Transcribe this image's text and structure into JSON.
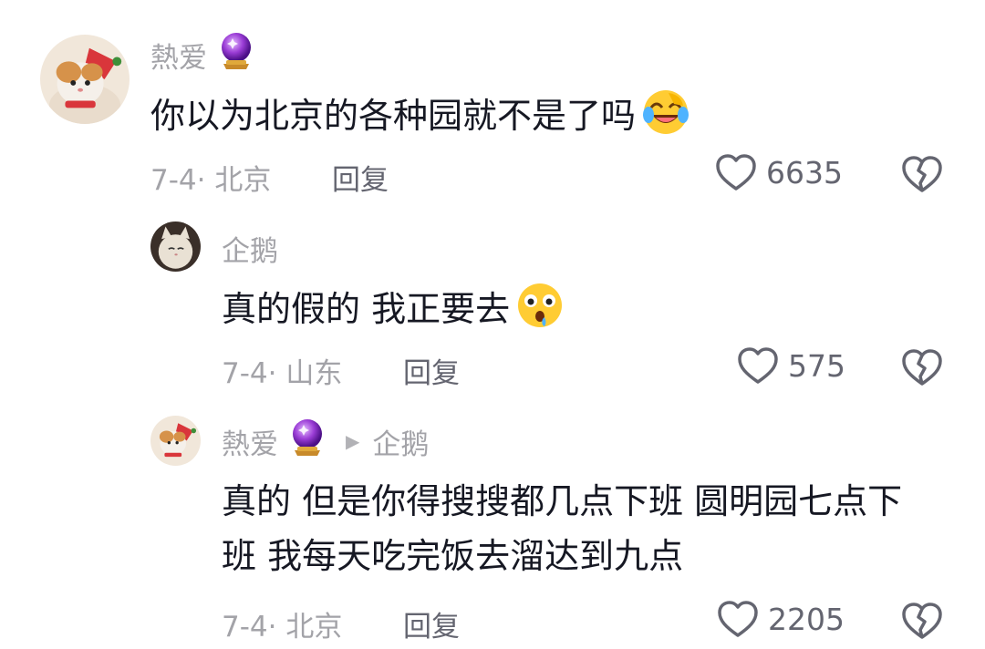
{
  "comments": [
    {
      "username": "熱爱",
      "badge_icon": "crystal-ball-icon",
      "text": "你以为北京的各种园就不是了吗",
      "emoji": "rolling-laugh-emoji",
      "date_location": "7-4· 北京",
      "reply_label": "回复",
      "likes": "6635"
    },
    {
      "username": "企鹅",
      "text": "真的假的 我正要去",
      "emoji": "surprised-drool-emoji",
      "date_location": "7-4· 山东",
      "reply_label": "回复",
      "likes": "575"
    },
    {
      "username": "熱爱",
      "badge_icon": "crystal-ball-icon",
      "reply_to": "企鹅",
      "text_line1": "真的 但是你得搜搜都几点下班 圆明园七点下",
      "text_line2": "班 我每天吃完饭去溜达到九点",
      "date_location": "7-4· 北京",
      "reply_label": "回复",
      "likes": "2205"
    }
  ],
  "colors": {
    "text": "#161823",
    "meta": "#a3a3a8",
    "action": "#646570",
    "crystal_ball": "#8a2be2"
  }
}
